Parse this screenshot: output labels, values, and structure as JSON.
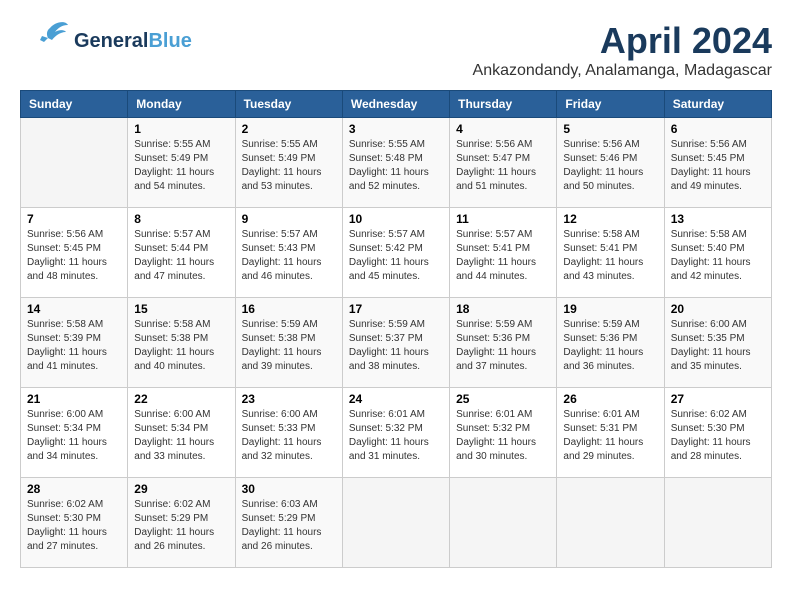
{
  "header": {
    "logo_general": "General",
    "logo_blue": "Blue",
    "month": "April 2024",
    "location": "Ankazondandy, Analamanga, Madagascar"
  },
  "calendar": {
    "days_of_week": [
      "Sunday",
      "Monday",
      "Tuesday",
      "Wednesday",
      "Thursday",
      "Friday",
      "Saturday"
    ],
    "weeks": [
      [
        {
          "num": "",
          "empty": true
        },
        {
          "num": "1",
          "sunrise": "5:55 AM",
          "sunset": "5:49 PM",
          "daylight": "11 hours and 54 minutes."
        },
        {
          "num": "2",
          "sunrise": "5:55 AM",
          "sunset": "5:49 PM",
          "daylight": "11 hours and 53 minutes."
        },
        {
          "num": "3",
          "sunrise": "5:55 AM",
          "sunset": "5:48 PM",
          "daylight": "11 hours and 52 minutes."
        },
        {
          "num": "4",
          "sunrise": "5:56 AM",
          "sunset": "5:47 PM",
          "daylight": "11 hours and 51 minutes."
        },
        {
          "num": "5",
          "sunrise": "5:56 AM",
          "sunset": "5:46 PM",
          "daylight": "11 hours and 50 minutes."
        },
        {
          "num": "6",
          "sunrise": "5:56 AM",
          "sunset": "5:45 PM",
          "daylight": "11 hours and 49 minutes."
        }
      ],
      [
        {
          "num": "7",
          "sunrise": "5:56 AM",
          "sunset": "5:45 PM",
          "daylight": "11 hours and 48 minutes."
        },
        {
          "num": "8",
          "sunrise": "5:57 AM",
          "sunset": "5:44 PM",
          "daylight": "11 hours and 47 minutes."
        },
        {
          "num": "9",
          "sunrise": "5:57 AM",
          "sunset": "5:43 PM",
          "daylight": "11 hours and 46 minutes."
        },
        {
          "num": "10",
          "sunrise": "5:57 AM",
          "sunset": "5:42 PM",
          "daylight": "11 hours and 45 minutes."
        },
        {
          "num": "11",
          "sunrise": "5:57 AM",
          "sunset": "5:41 PM",
          "daylight": "11 hours and 44 minutes."
        },
        {
          "num": "12",
          "sunrise": "5:58 AM",
          "sunset": "5:41 PM",
          "daylight": "11 hours and 43 minutes."
        },
        {
          "num": "13",
          "sunrise": "5:58 AM",
          "sunset": "5:40 PM",
          "daylight": "11 hours and 42 minutes."
        }
      ],
      [
        {
          "num": "14",
          "sunrise": "5:58 AM",
          "sunset": "5:39 PM",
          "daylight": "11 hours and 41 minutes."
        },
        {
          "num": "15",
          "sunrise": "5:58 AM",
          "sunset": "5:38 PM",
          "daylight": "11 hours and 40 minutes."
        },
        {
          "num": "16",
          "sunrise": "5:59 AM",
          "sunset": "5:38 PM",
          "daylight": "11 hours and 39 minutes."
        },
        {
          "num": "17",
          "sunrise": "5:59 AM",
          "sunset": "5:37 PM",
          "daylight": "11 hours and 38 minutes."
        },
        {
          "num": "18",
          "sunrise": "5:59 AM",
          "sunset": "5:36 PM",
          "daylight": "11 hours and 37 minutes."
        },
        {
          "num": "19",
          "sunrise": "5:59 AM",
          "sunset": "5:36 PM",
          "daylight": "11 hours and 36 minutes."
        },
        {
          "num": "20",
          "sunrise": "6:00 AM",
          "sunset": "5:35 PM",
          "daylight": "11 hours and 35 minutes."
        }
      ],
      [
        {
          "num": "21",
          "sunrise": "6:00 AM",
          "sunset": "5:34 PM",
          "daylight": "11 hours and 34 minutes."
        },
        {
          "num": "22",
          "sunrise": "6:00 AM",
          "sunset": "5:34 PM",
          "daylight": "11 hours and 33 minutes."
        },
        {
          "num": "23",
          "sunrise": "6:00 AM",
          "sunset": "5:33 PM",
          "daylight": "11 hours and 32 minutes."
        },
        {
          "num": "24",
          "sunrise": "6:01 AM",
          "sunset": "5:32 PM",
          "daylight": "11 hours and 31 minutes."
        },
        {
          "num": "25",
          "sunrise": "6:01 AM",
          "sunset": "5:32 PM",
          "daylight": "11 hours and 30 minutes."
        },
        {
          "num": "26",
          "sunrise": "6:01 AM",
          "sunset": "5:31 PM",
          "daylight": "11 hours and 29 minutes."
        },
        {
          "num": "27",
          "sunrise": "6:02 AM",
          "sunset": "5:30 PM",
          "daylight": "11 hours and 28 minutes."
        }
      ],
      [
        {
          "num": "28",
          "sunrise": "6:02 AM",
          "sunset": "5:30 PM",
          "daylight": "11 hours and 27 minutes."
        },
        {
          "num": "29",
          "sunrise": "6:02 AM",
          "sunset": "5:29 PM",
          "daylight": "11 hours and 26 minutes."
        },
        {
          "num": "30",
          "sunrise": "6:03 AM",
          "sunset": "5:29 PM",
          "daylight": "11 hours and 26 minutes."
        },
        {
          "num": "",
          "empty": true
        },
        {
          "num": "",
          "empty": true
        },
        {
          "num": "",
          "empty": true
        },
        {
          "num": "",
          "empty": true
        }
      ]
    ]
  }
}
